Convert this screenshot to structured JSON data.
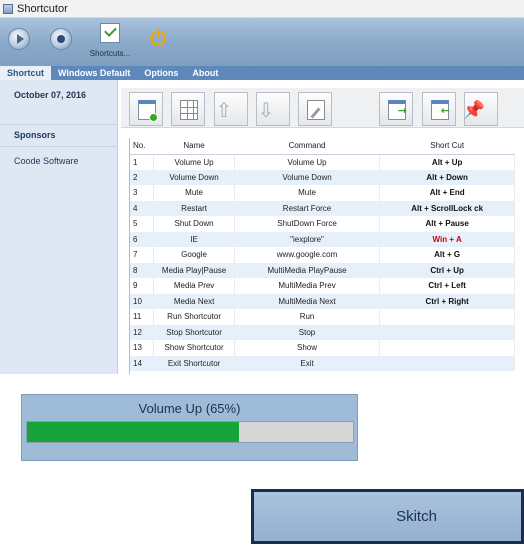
{
  "window": {
    "title": "Shortcutor",
    "ribbon": {
      "shortcuts_label": "Shortcuts..."
    },
    "tabs": [
      "Shortcut",
      "Windows Default",
      "Options",
      "About"
    ],
    "sidebar": {
      "date": "October 07, 2016",
      "sponsors_label": "Sponsors",
      "sponsor_link": "Coode Software"
    },
    "table": {
      "headers": [
        "No.",
        "Name",
        "Command",
        "Short Cut"
      ],
      "rows": [
        [
          "1",
          "Volume Up",
          "Volume Up",
          "Alt + Up"
        ],
        [
          "2",
          "Volume Down",
          "Volume Down",
          "Alt + Down"
        ],
        [
          "3",
          "Mute",
          "Mute",
          "Alt + End"
        ],
        [
          "4",
          "Restart",
          "Restart Force",
          "Alt + ScrollLock ck"
        ],
        [
          "5",
          "Shut Down",
          "ShutDown Force",
          "Alt + Pause"
        ],
        [
          "6",
          "IE",
          "\"iexplore\"",
          "Win + A"
        ],
        [
          "7",
          "Google",
          "www.google.com",
          "Alt + G"
        ],
        [
          "8",
          "Media Play|Pause",
          "MultiMedia PlayPause",
          "Ctrl + Up"
        ],
        [
          "9",
          "Media Prev",
          "MultiMedia Prev",
          "Ctrl + Left"
        ],
        [
          "10",
          "Media Next",
          "MultiMedia Next",
          "Ctrl + Right"
        ],
        [
          "11",
          "Run Shortcutor",
          "Run",
          ""
        ],
        [
          "12",
          "Stop Shortcutor",
          "Stop",
          ""
        ],
        [
          "13",
          "Show Shortcutor",
          "Show",
          ""
        ],
        [
          "14",
          "Exit Shortcutor",
          "Exit",
          ""
        ]
      ],
      "highlight_color": "#d40000"
    }
  },
  "progress_popup": {
    "label": "Volume Up (65%)",
    "value": 0.65,
    "fill_color": "#16a33a"
  },
  "skitch_popup": {
    "label": "Skitch"
  },
  "icons": {
    "ribbon": [
      "play-icon",
      "stop-icon",
      "shortcuts-icon",
      "power-icon"
    ],
    "toolbar": [
      "add-shortcut-icon",
      "grid-icon",
      "up-arrow-icon",
      "down-arrow-icon",
      "edit-icon",
      "export-icon",
      "import-icon",
      "pin-icon"
    ]
  }
}
